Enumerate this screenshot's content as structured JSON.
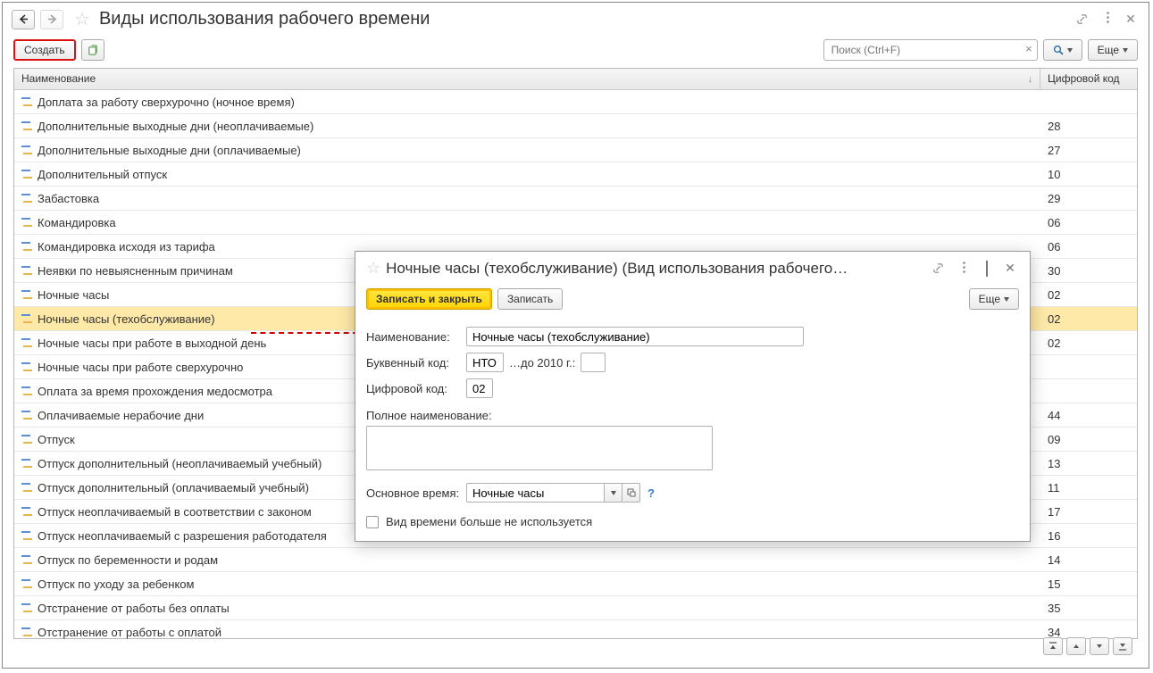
{
  "titlebar": {
    "title": "Виды использования рабочего времени"
  },
  "toolbar": {
    "create": "Создать",
    "search_placeholder": "Поиск (Ctrl+F)",
    "more": "Еще"
  },
  "grid_header": {
    "name": "Наименование",
    "code": "Цифровой код"
  },
  "rows": [
    {
      "name": "Доплата за работу сверхурочно (ночное время)",
      "code": ""
    },
    {
      "name": "Дополнительные выходные дни (неоплачиваемые)",
      "code": "28"
    },
    {
      "name": "Дополнительные выходные дни (оплачиваемые)",
      "code": "27"
    },
    {
      "name": "Дополнительный отпуск",
      "code": "10"
    },
    {
      "name": "Забастовка",
      "code": "29"
    },
    {
      "name": "Командировка",
      "code": "06"
    },
    {
      "name": "Командировка исходя из тарифа",
      "code": "06"
    },
    {
      "name": "Неявки по невыясненным причинам",
      "code": "30"
    },
    {
      "name": "Ночные часы",
      "code": "02"
    },
    {
      "name": "Ночные часы (техобслуживание)",
      "code": "02",
      "selected": true
    },
    {
      "name": "Ночные часы при работе в выходной день",
      "code": "02"
    },
    {
      "name": "Ночные часы при работе сверхурочно",
      "code": ""
    },
    {
      "name": "Оплата за время прохождения медосмотра",
      "code": ""
    },
    {
      "name": "Оплачиваемые нерабочие дни",
      "code": "44"
    },
    {
      "name": "Отпуск",
      "code": "09"
    },
    {
      "name": "Отпуск дополнительный (неоплачиваемый учебный)",
      "code": "13"
    },
    {
      "name": "Отпуск дополнительный (оплачиваемый учебный)",
      "code": "11"
    },
    {
      "name": "Отпуск неоплачиваемый в соответствии с законом",
      "code": "17"
    },
    {
      "name": "Отпуск неоплачиваемый с разрешения работодателя",
      "code": "16"
    },
    {
      "name": "Отпуск по беременности и родам",
      "code": "14"
    },
    {
      "name": "Отпуск по уходу за ребенком",
      "code": "15"
    },
    {
      "name": "Отстранение от работы без оплаты",
      "code": "35"
    },
    {
      "name": "Отстранение от работы с оплатой",
      "code": "34"
    }
  ],
  "dialog": {
    "title": "Ночные часы (техобслуживание) (Вид использования рабочего…",
    "save_close": "Записать и закрыть",
    "save": "Записать",
    "more": "Еще",
    "labels": {
      "name": "Наименование:",
      "alpha": "Буквенный код:",
      "old": "…до 2010 г.:",
      "num": "Цифровой код:",
      "full": "Полное наименование:",
      "main": "Основное время:",
      "disabled": "Вид времени больше не используется"
    },
    "values": {
      "name": "Ночные часы (техобслуживание)",
      "alpha": "НТО",
      "old": "",
      "num": "02",
      "full": "",
      "main": "Ночные часы"
    }
  }
}
